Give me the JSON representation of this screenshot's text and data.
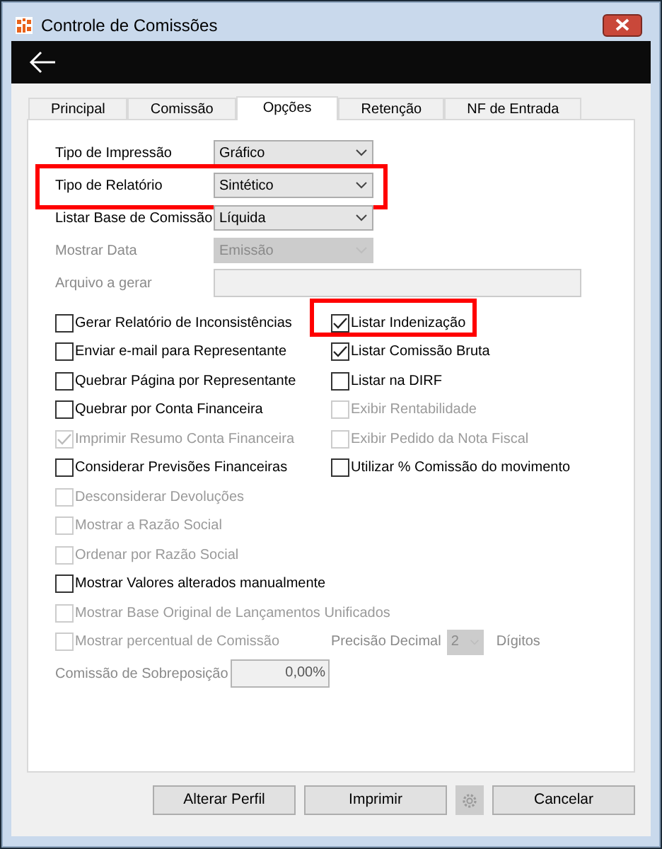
{
  "window": {
    "title": "Controle de Comissões"
  },
  "tabs": [
    {
      "label": "Principal",
      "selected": false
    },
    {
      "label": "Comissão",
      "selected": false
    },
    {
      "label": "Opções",
      "selected": true
    },
    {
      "label": "Retenção",
      "selected": false
    },
    {
      "label": "NF de Entrada",
      "selected": false
    }
  ],
  "fields": [
    {
      "kind": "select",
      "label": "Tipo de Impressão",
      "value": "Gráfico",
      "disabled": false,
      "highlighted": false
    },
    {
      "kind": "select",
      "label": "Tipo de Relatório",
      "value": "Sintético",
      "disabled": false,
      "highlighted": true
    },
    {
      "kind": "select",
      "label": "Listar Base de Comissão",
      "value": "Líquida",
      "disabled": false,
      "highlighted": false
    },
    {
      "kind": "select",
      "label": "Mostrar Data",
      "value": "Emissão",
      "disabled": true,
      "highlighted": false
    },
    {
      "kind": "text",
      "label": "Arquivo a gerar",
      "disabled": true,
      "highlighted": false
    }
  ],
  "options_left": [
    {
      "label": "Gerar Relatório de Inconsistências",
      "checked": false,
      "disabled": false
    },
    {
      "label": "Enviar e-mail para Representante",
      "checked": false,
      "disabled": false
    },
    {
      "label": "Quebrar Página por Representante",
      "checked": false,
      "disabled": false
    },
    {
      "label": "Quebrar por Conta Financeira",
      "checked": false,
      "disabled": false
    },
    {
      "label": "Imprimir Resumo Conta Financeira",
      "checked": true,
      "disabled": true
    },
    {
      "label": "Considerar Previsões Financeiras",
      "checked": false,
      "disabled": false
    },
    {
      "label": "Desconsiderar Devoluções",
      "checked": false,
      "disabled": true
    },
    {
      "label": "Mostrar a Razão Social",
      "checked": false,
      "disabled": true
    },
    {
      "label": "Ordenar por Razão Social",
      "checked": false,
      "disabled": true
    },
    {
      "label": "Mostrar Valores alterados manualmente",
      "checked": false,
      "disabled": false
    },
    {
      "label": "Mostrar Base Original de Lançamentos Unificados",
      "checked": false,
      "disabled": true
    },
    {
      "label": "Mostrar percentual de Comissão",
      "checked": false,
      "disabled": true
    }
  ],
  "options_right": [
    {
      "label": "Listar Indenização",
      "checked": true,
      "disabled": false,
      "highlighted": true
    },
    {
      "label": "Listar Comissão Bruta",
      "checked": true,
      "disabled": false,
      "highlighted": false
    },
    {
      "label": "Listar na DIRF",
      "checked": false,
      "disabled": false,
      "highlighted": false
    },
    {
      "label": "Exibir Rentabilidade",
      "checked": false,
      "disabled": true,
      "highlighted": false
    },
    {
      "label": "Exibir Pedido da Nota Fiscal",
      "checked": false,
      "disabled": true,
      "highlighted": false
    },
    {
      "label": "Utilizar % Comissão do movimento",
      "checked": false,
      "disabled": false,
      "highlighted": false
    }
  ],
  "precision": {
    "label": "Precisão Decimal",
    "value": "2",
    "unit": "Dígitos",
    "disabled": true
  },
  "overlap": {
    "label": "Comissão de Sobreposição",
    "value": "0,00%"
  },
  "buttons": [
    {
      "kind": "text",
      "label": "Alterar Perfil"
    },
    {
      "kind": "text",
      "label": "Imprimir"
    },
    {
      "kind": "icon",
      "disabled": true
    },
    {
      "kind": "text",
      "label": "Cancelar"
    }
  ]
}
